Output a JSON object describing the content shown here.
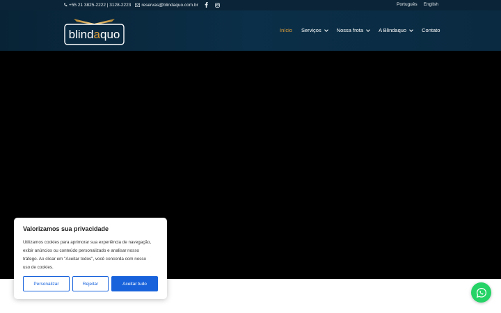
{
  "topbar": {
    "phone": "+55 21 3825-2222 | 3128-2223",
    "email": "reservas@blindaquo.com.br",
    "languages": [
      "Português",
      "English"
    ]
  },
  "header": {
    "logo_text": "blindaquo",
    "nav": [
      {
        "label": "Início",
        "active": true,
        "dropdown": false
      },
      {
        "label": "Serviços",
        "active": false,
        "dropdown": true
      },
      {
        "label": "Nossa frota",
        "active": false,
        "dropdown": true
      },
      {
        "label": "A Blindaquo",
        "active": false,
        "dropdown": true
      },
      {
        "label": "Contato",
        "active": false,
        "dropdown": false
      }
    ]
  },
  "cookie": {
    "title": "Valorizamos sua privacidade",
    "body": "Utilizamos cookies para aprimorar sua experiência de navegação, exibir anúncios ou conteúdo personalizado e analisar nosso tráfego. Ao clicar em \"Aceitar todos\", você concorda com nosso uso de cookies.",
    "customize_label": "Personalizar",
    "reject_label": "Rejeitar",
    "accept_label": "Aceitar tudo"
  },
  "colors": {
    "topbar_bg": "#0b2437",
    "header_bg": "#0a2a41",
    "accent": "#e0a03a",
    "cookie_button": "#1863dc",
    "whatsapp": "#25d366"
  },
  "icons": [
    "phone-icon",
    "mail-icon",
    "facebook-icon",
    "instagram-icon",
    "chevron-down-icon",
    "whatsapp-icon"
  ]
}
